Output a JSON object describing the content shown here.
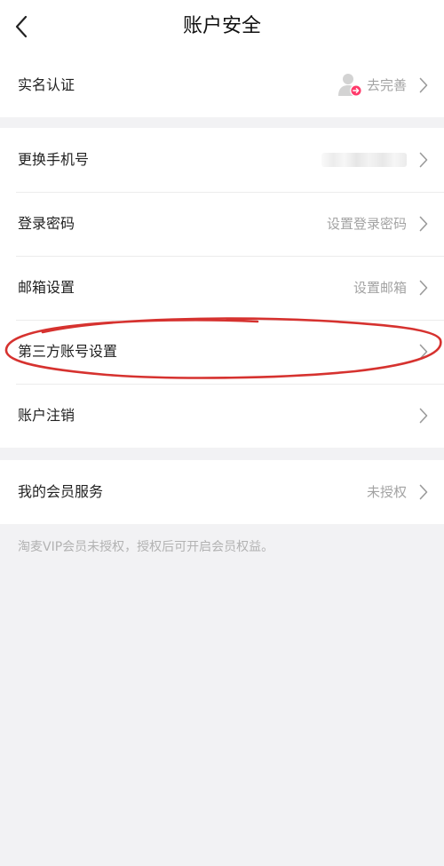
{
  "header": {
    "title": "账户安全",
    "back_icon": "chevron-left-icon"
  },
  "group1": {
    "realname": {
      "label": "实名认证",
      "value": "去完善",
      "badge_color": "#ff3b6b"
    }
  },
  "group2": {
    "phone": {
      "label": "更换手机号"
    },
    "password": {
      "label": "登录密码",
      "value": "设置登录密码"
    },
    "email": {
      "label": "邮箱设置",
      "value": "设置邮箱"
    },
    "third_party": {
      "label": "第三方账号设置"
    },
    "cancel_account": {
      "label": "账户注销"
    }
  },
  "group3": {
    "membership": {
      "label": "我的会员服务",
      "value": "未授权"
    }
  },
  "note": "淘麦VIP会员未授权，授权后可开启会员权益。",
  "colors": {
    "background": "#f2f2f4",
    "annotation_circle": "#d6322f",
    "secondary_text": "#a3a3a3"
  }
}
